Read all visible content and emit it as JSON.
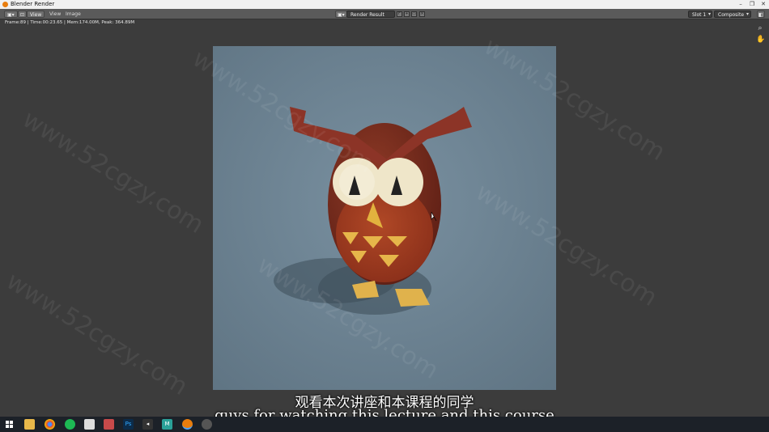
{
  "window": {
    "title": "Blender Render"
  },
  "header": {
    "view_label": "View",
    "view_menu": "View",
    "image_menu": "Image",
    "image_name": "Render Result",
    "slot_value": "Slot 1",
    "pass_value": "Composite"
  },
  "stats": "Frame:89 | Time:00:23.65 | Mem:174.00M, Peak: 364.89M",
  "watermark": "www.52cgzy.com",
  "subtitles": {
    "chinese": "观看本次讲座和本课程的同学",
    "english": "guys for watching this lecture and this course"
  },
  "colors": {
    "background": "#3c3c3c",
    "render_bg": "#687d8b",
    "owl_body": "#7a2b1c",
    "owl_belly": "#a23d1f",
    "accent_yellow": "#e6b64a"
  },
  "taskbar": {
    "icons": [
      "windows-start-icon",
      "file-explorer-icon",
      "chrome-icon",
      "spotify-icon",
      "app-icon",
      "mail-icon",
      "photoshop-icon",
      "visual-studio-icon",
      "maya-icon",
      "blender-icon",
      "recorder-icon"
    ],
    "ps_label": "Ps"
  }
}
